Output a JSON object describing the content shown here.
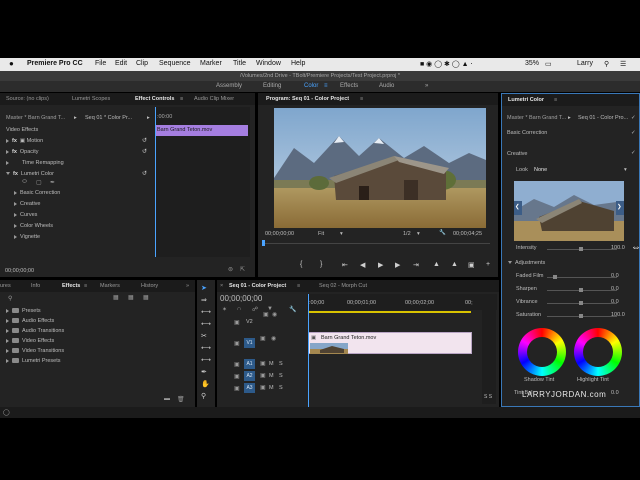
{
  "menubar": {
    "apple": "",
    "app_name": "Premiere Pro CC",
    "items": [
      "File",
      "Edit",
      "Clip",
      "Sequence",
      "Marker",
      "Title",
      "Window",
      "Help"
    ],
    "battery": "35%",
    "user": "Larry"
  },
  "window_title": "/Volumes/2nd Drive - TBolt/Premiere Projects/Test Project.prproj *",
  "workspaces": [
    "Assembly",
    "Editing",
    "Color",
    "Effects",
    "Audio"
  ],
  "source_panel": {
    "tabs": [
      "Source: (no clips)",
      "Lumetri Scopes",
      "Effect Controls",
      "Audio Clip Mixer"
    ],
    "master_label": "Master * Barn Grand T...",
    "seq_label": "Seq 01 * Color Pr...",
    "clip_bar": "Barn Grand Teton.mov",
    "timecode_ruler": ":00:00",
    "video_effects": "Video Effects",
    "effects": [
      {
        "fx": "fx",
        "name": "Motion"
      },
      {
        "fx": "fx",
        "name": "Opacity"
      },
      {
        "fx": "",
        "name": "Time Remapping"
      },
      {
        "fx": "fx",
        "name": "Lumetri Color"
      }
    ],
    "lumetri_sections": [
      "Basic Correction",
      "Creative",
      "Curves",
      "Color Wheels",
      "Vignette"
    ],
    "timecode": "00;00;00;00"
  },
  "program_panel": {
    "title": "Program: Seq 01 - Color Project",
    "timecode_left": "00;00;00;00",
    "fit": "Fit",
    "resolution": "1/2",
    "timecode_right": "00;00;04;25"
  },
  "project_panel": {
    "tabs": [
      "ures",
      "Info",
      "Effects",
      "Markers",
      "History"
    ],
    "folders": [
      "Presets",
      "Audio Effects",
      "Audio Transitions",
      "Video Effects",
      "Video Transitions",
      "Lumetri Presets"
    ]
  },
  "timeline": {
    "tabs": [
      "Seq 01 - Color Project",
      "Seq 02 - Morph Cut"
    ],
    "timecode": "00;00;00;00",
    "ruler": [
      ":00;00",
      "00;00;01;00",
      "00;00;02;00",
      "00;"
    ],
    "video_tracks": [
      "V2",
      "V1"
    ],
    "audio_tracks": [
      "A1",
      "A2",
      "A3"
    ],
    "clip_name": "Barn Grand Teton.mov",
    "track_letters": [
      "M",
      "S"
    ]
  },
  "lumetri": {
    "title": "Lumetri Color",
    "master_label": "Master * Barn Grand T...",
    "seq_label": "Seq 01 - Color Pro...",
    "basic_correction": "Basic Correction",
    "creative": "Creative",
    "look_label": "Look",
    "look_value": "None",
    "intensity_label": "Intensity",
    "intensity_value": "100.0",
    "adjustments": "Adjustments",
    "adjust_rows": [
      {
        "label": "Faded Film",
        "value": "0.0"
      },
      {
        "label": "Sharpen",
        "value": "0.0"
      },
      {
        "label": "Vibrance",
        "value": "0.0"
      },
      {
        "label": "Saturation",
        "value": "100.0"
      }
    ],
    "shadow_tint": "Shadow Tint",
    "highlight_tint": "Highlight Tint",
    "tint_balance_label": "Tint Bal",
    "tint_balance_value": "0.0"
  },
  "watermark": "LARRYJORDAN.com",
  "colors": {
    "accent_blue": "#3f8fd9",
    "clip_purple": "#a57ee0",
    "playhead_blue": "#4aa3ff"
  }
}
